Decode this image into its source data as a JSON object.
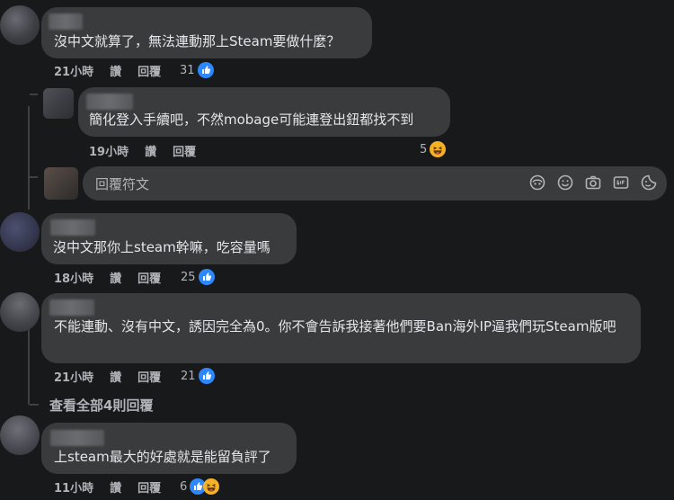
{
  "colors": {
    "background": "#18191a",
    "bubble": "#3a3b3c",
    "like_blue": "#2d88ff",
    "haha_yellow": "#f7b125"
  },
  "comments": [
    {
      "text": "沒中文就算了，無法連動那上Steam要做什麼？",
      "time": "21小時",
      "like": "讚",
      "reply": "回覆",
      "reaction_count": "31",
      "reactions": [
        "like-icon"
      ]
    },
    {
      "text": "簡化登入手續吧，不然mobage可能連登出鈕都找不到",
      "time": "19小時",
      "like": "讚",
      "reply": "回覆",
      "reaction_count": "5",
      "reactions": [
        "haha-icon"
      ]
    },
    {
      "text": "沒中文那你上steam幹嘛，吃容量嗎",
      "time": "18小時",
      "like": "讚",
      "reply": "回覆",
      "reaction_count": "25",
      "reactions": [
        "like-icon"
      ]
    },
    {
      "text": "不能連動、沒有中文，誘因完全為0。你不會告訴我接著他們要Ban海外IP逼我們玩Steam版吧",
      "time": "21小時",
      "like": "讚",
      "reply": "回覆",
      "reaction_count": "21",
      "reactions": [
        "like-icon"
      ]
    },
    {
      "text": "上steam最大的好處就是能留負評了",
      "time": "11小時",
      "like": "讚",
      "reply": "回覆",
      "reaction_count": "6",
      "reactions": [
        "like-icon",
        "haha-icon"
      ]
    }
  ],
  "reply_box": {
    "placeholder": "回覆符文",
    "icons": [
      "avatar-sticker-icon",
      "emoji-icon",
      "camera-icon",
      "gif-icon",
      "sticker-icon"
    ]
  },
  "view_more": "查看全部4則回覆"
}
